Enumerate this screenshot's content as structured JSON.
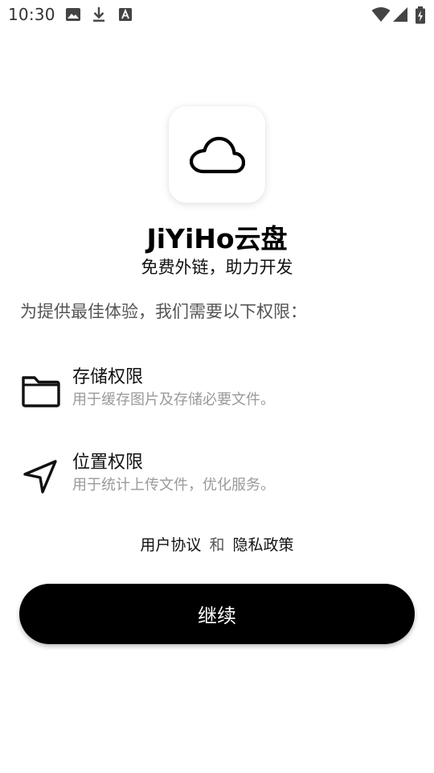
{
  "status_bar": {
    "time": "10:30",
    "icons": [
      "image-icon",
      "download-icon",
      "font-a-icon",
      "wifi-icon",
      "signal-icon",
      "battery-charging-icon"
    ]
  },
  "app": {
    "logo_icon": "cloud-icon",
    "title": "JiYiHo云盘",
    "subtitle": "免费外链，助力开发"
  },
  "intro": "为提供最佳体验，我们需要以下权限：",
  "permissions": [
    {
      "icon": "folder-icon",
      "title": "存储权限",
      "description": "用于缓存图片及存储必要文件。"
    },
    {
      "icon": "location-arrow-icon",
      "title": "位置权限",
      "description": "用于统计上传文件，优化服务。"
    }
  ],
  "agreement": {
    "user_agreement": "用户协议",
    "and": "和",
    "privacy_policy": "隐私政策"
  },
  "continue_label": "继续",
  "colors": {
    "button_bg": "#000000",
    "button_text": "#ffffff",
    "secondary_text": "#9a9a9a"
  }
}
